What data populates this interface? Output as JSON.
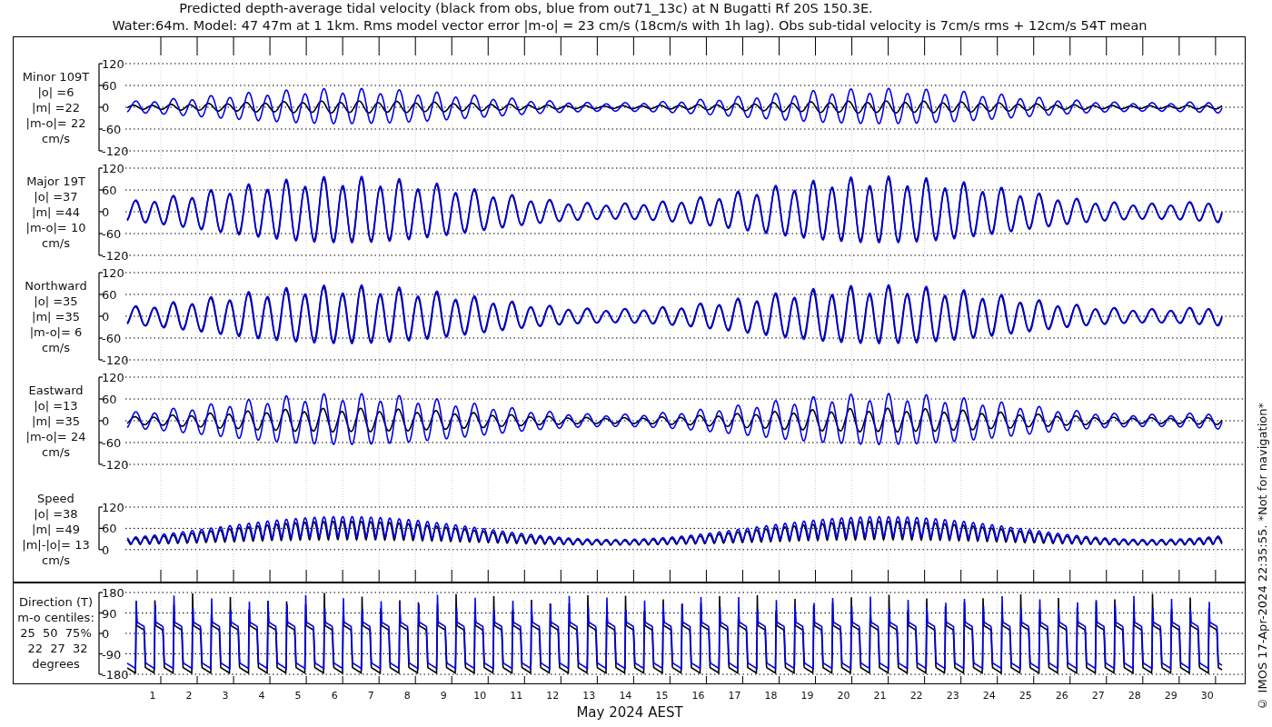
{
  "title_lines": [
    "Predicted depth-average tidal velocity (black from obs, blue from out71_13c) at N Bugatti Rf 20S 150.3E.",
    "Water:64m. Model: 47 47m at 1 1km. Rms model vector error |m-o| = 23 cm/s (18cm/s with 1h lag). Obs sub-tidal velocity is 7cm/s rms + 12cm/s 54T mean"
  ],
  "panels": [
    {
      "kind": "velocity",
      "label": "Minor 109T\n|o| =6\n|m| =22\n|m-o|= 22\ncm/s",
      "yticks": [
        "120",
        "60",
        "0",
        "-60",
        "-120"
      ]
    },
    {
      "kind": "velocity",
      "label": "Major 19T\n|o| =37\n|m| =44\n|m-o|= 10\ncm/s",
      "yticks": [
        "120",
        "60",
        "0",
        "-60",
        "-120"
      ]
    },
    {
      "kind": "velocity",
      "label": "Northward\n|o| =35\n|m| =35\n|m-o|= 6\ncm/s",
      "yticks": [
        "120",
        "60",
        "0",
        "-60",
        "-120"
      ]
    },
    {
      "kind": "velocity",
      "label": "Eastward\n|o| =13\n|m| =35\n|m-o|= 24\ncm/s",
      "yticks": [
        "120",
        "60",
        "0",
        "-60",
        "-120"
      ]
    },
    {
      "kind": "speed",
      "label": "Speed\n|o| =38\n|m| =49\n|m|-|o|= 13\ncm/s",
      "yticks": [
        "120",
        "60",
        "0"
      ]
    },
    {
      "kind": "direction",
      "label": "Direction (T)\nm-o centiles:\n25  50  75%\n 22  27  32\ndegrees",
      "yticks": [
        "180",
        "90",
        "0",
        "-90",
        "-180"
      ]
    }
  ],
  "x_axis": {
    "day_labels": [
      "1",
      "2",
      "3",
      "4",
      "5",
      "6",
      "7",
      "8",
      "9",
      "10",
      "11",
      "12",
      "13",
      "14",
      "15",
      "16",
      "17",
      "18",
      "19",
      "20",
      "21",
      "22",
      "23",
      "24",
      "25",
      "26",
      "27",
      "28",
      "29",
      "30"
    ],
    "label": "May 2024 AEST"
  },
  "footnote": "© IMOS 17-Apr-2024 22:35:55. *Not for navigation*"
}
